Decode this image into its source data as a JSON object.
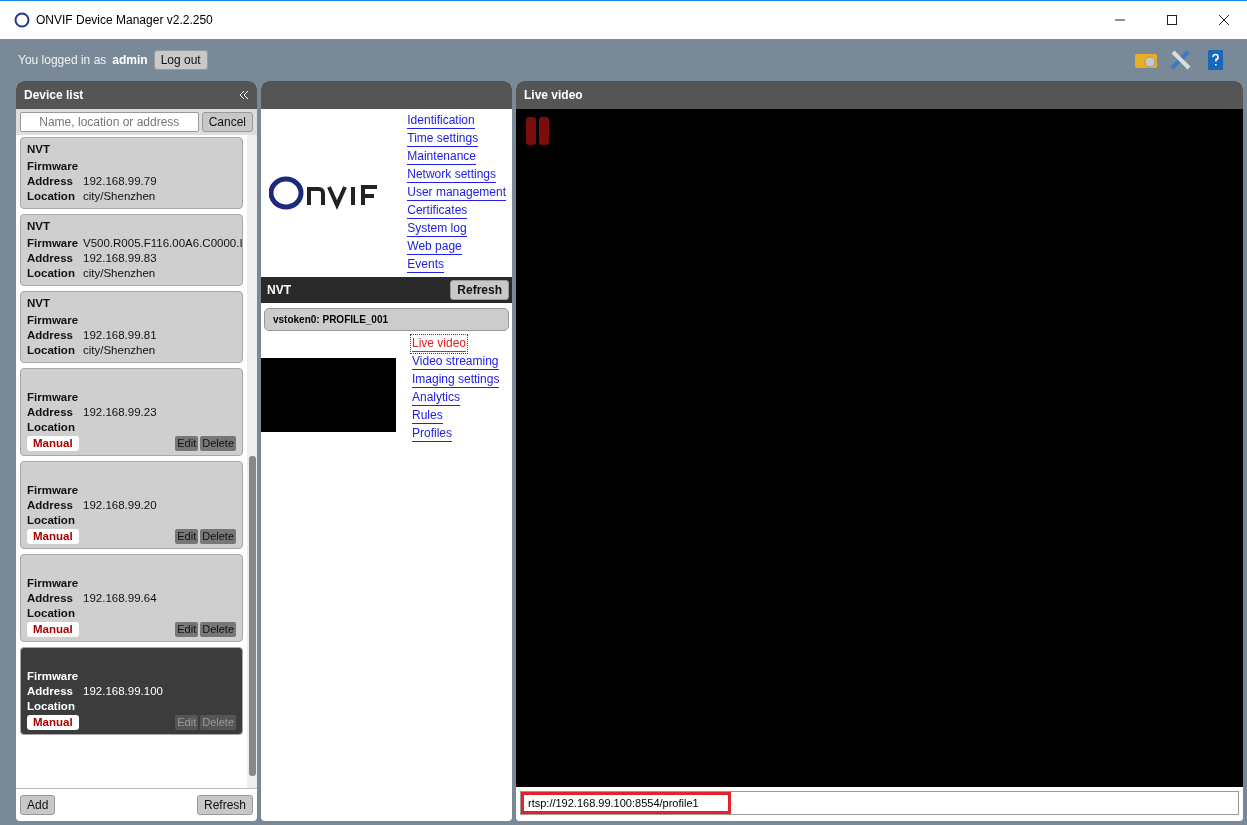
{
  "window": {
    "title": "ONVIF Device Manager v2.2.250"
  },
  "session": {
    "prefix": "You logged in as",
    "user": "admin",
    "logout": "Log out"
  },
  "device_list": {
    "title": "Device list",
    "search_placeholder": "Name, location or address",
    "cancel": "Cancel",
    "add": "Add",
    "refresh": "Refresh",
    "devices": [
      {
        "name": "NVT",
        "fields": [
          {
            "label": "Firmware"
          },
          {
            "label": "Address",
            "value": "192.168.99.79"
          },
          {
            "label": "Location",
            "value": "city/Shenzhen"
          }
        ],
        "selected": false
      },
      {
        "name": "NVT",
        "fields": [
          {
            "label": "Firmware",
            "value": "V500.R005.F116.00A6.C0000.I"
          },
          {
            "label": "Address",
            "value": "192.168.99.83"
          },
          {
            "label": "Location",
            "value": "city/Shenzhen"
          }
        ],
        "selected": false
      },
      {
        "name": "NVT",
        "fields": [
          {
            "label": "Firmware"
          },
          {
            "label": "Address",
            "value": "192.168.99.81"
          },
          {
            "label": "Location",
            "value": "city/Shenzhen"
          }
        ],
        "selected": false
      },
      {
        "fields": [
          {
            "label": "Firmware"
          },
          {
            "label": "Address",
            "value": "192.168.99.23"
          },
          {
            "label": "Location"
          }
        ],
        "tag": {
          "text": "Manual",
          "edit": "Edit",
          "delete": "Delete"
        },
        "selected": false
      },
      {
        "fields": [
          {
            "label": "Firmware"
          },
          {
            "label": "Address",
            "value": "192.168.99.20"
          },
          {
            "label": "Location"
          }
        ],
        "tag": {
          "text": "Manual",
          "edit": "Edit",
          "delete": "Delete"
        },
        "selected": false
      },
      {
        "fields": [
          {
            "label": "Firmware"
          },
          {
            "label": "Address",
            "value": "192.168.99.64"
          },
          {
            "label": "Location"
          }
        ],
        "tag": {
          "text": "Manual",
          "edit": "Edit",
          "delete": "Delete"
        },
        "selected": false
      },
      {
        "fields": [
          {
            "label": "Firmware"
          },
          {
            "label": "Address",
            "value": "192.168.99.100"
          },
          {
            "label": "Location"
          }
        ],
        "tag": {
          "text": "Manual",
          "edit": "Edit",
          "delete": "Delete"
        },
        "selected": true
      }
    ]
  },
  "device_panel": {
    "links": [
      "Identification",
      "Time settings",
      "Maintenance",
      "Network settings",
      "User management",
      "Certificates",
      "System log",
      "Web page",
      "Events"
    ],
    "name": "NVT",
    "refresh": "Refresh",
    "profile": "vstoken0: PROFILE_001",
    "profile_links": [
      {
        "label": "Live video",
        "selected": true
      },
      {
        "label": "Video streaming",
        "selected": false
      },
      {
        "label": "Imaging settings",
        "selected": false
      },
      {
        "label": "Analytics",
        "selected": false
      },
      {
        "label": "Rules",
        "selected": false
      },
      {
        "label": "Profiles",
        "selected": false
      }
    ]
  },
  "live_video": {
    "title": "Live video",
    "url": "rtsp://192.168.99.100:8554/profile1",
    "url_highlighted": true
  }
}
